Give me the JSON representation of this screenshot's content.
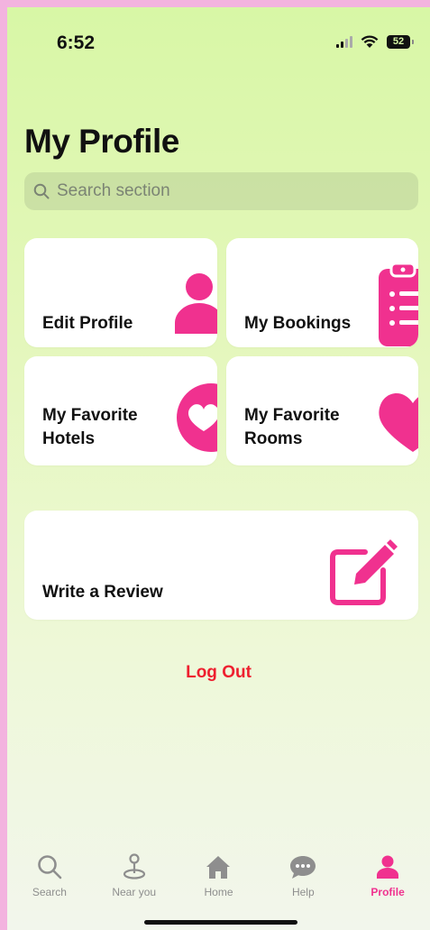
{
  "status_bar": {
    "time": "6:52",
    "battery": "52"
  },
  "header": {
    "title": "My Profile"
  },
  "search": {
    "placeholder": "Search section"
  },
  "cards": {
    "edit_profile": {
      "label": "Edit Profile",
      "icon": "person-icon"
    },
    "my_bookings": {
      "label": "My Bookings",
      "icon": "clipboard-list-icon"
    },
    "favorite_hotels": {
      "line1": "My Favorite",
      "line2": "Hotels",
      "icon": "heart-badge-icon"
    },
    "favorite_rooms": {
      "line1": "My Favorite",
      "line2": "Rooms",
      "icon": "heart-icon"
    },
    "write_review": {
      "label": "Write a Review",
      "icon": "edit-square-icon"
    }
  },
  "logout": {
    "label": "Log Out"
  },
  "tabs": [
    {
      "label": "Search",
      "icon": "search-icon",
      "active": false
    },
    {
      "label": "Near you",
      "icon": "map-pin-icon",
      "active": false
    },
    {
      "label": "Home",
      "icon": "home-icon",
      "active": false
    },
    {
      "label": "Help",
      "icon": "chat-bubble-icon",
      "active": false
    },
    {
      "label": "Profile",
      "icon": "person-icon",
      "active": true
    }
  ],
  "colors": {
    "accent": "#f0318f",
    "logout": "#ee1f2f",
    "background_top": "#d8f7a6"
  }
}
